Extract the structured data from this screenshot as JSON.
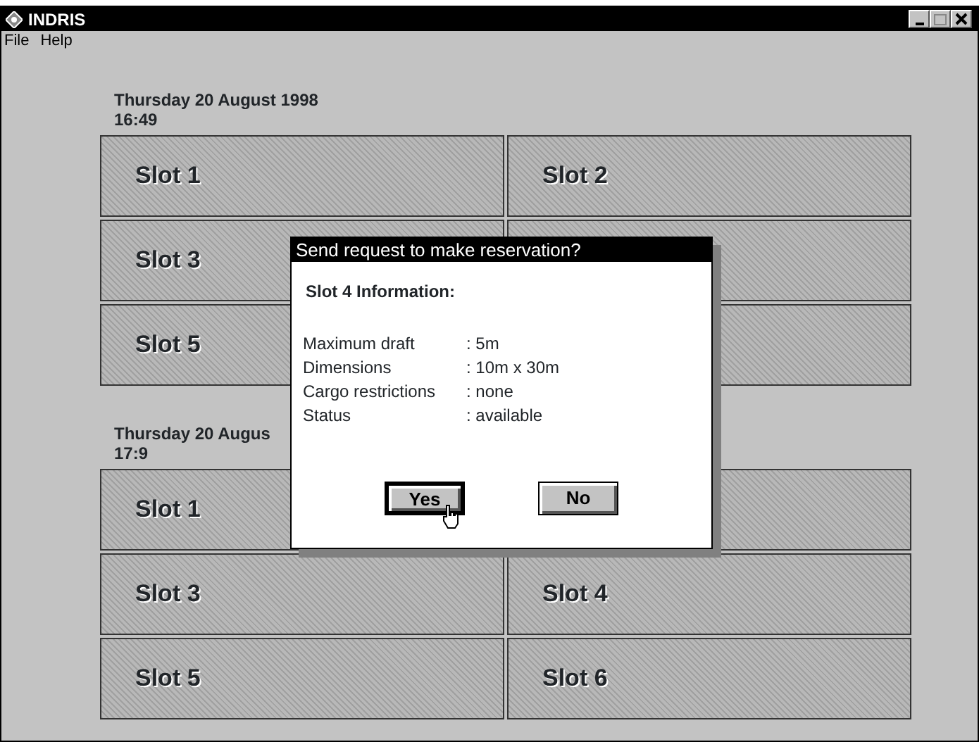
{
  "window": {
    "title": "INDRIS"
  },
  "menu": [
    "File",
    "Help"
  ],
  "groups": [
    {
      "date": "Thursday 20 August 1998",
      "time": "16:49",
      "slots": [
        {
          "kind": "slot",
          "label": "Slot 1"
        },
        {
          "kind": "slot",
          "label": "Slot 2"
        },
        {
          "kind": "slot",
          "label": "Slot 3"
        },
        {
          "kind": "covered"
        },
        {
          "kind": "slot",
          "label": "Slot 5"
        },
        {
          "kind": "covered"
        }
      ]
    },
    {
      "date": "Thursday 20 Augus",
      "time": "17:9",
      "slots": [
        {
          "kind": "slot",
          "label": "Slot 1"
        },
        {
          "kind": "covered"
        },
        {
          "kind": "slot",
          "label": "Slot 3"
        },
        {
          "kind": "slot",
          "label": "Slot 4"
        },
        {
          "kind": "slot",
          "label": "Slot 5"
        },
        {
          "kind": "slot",
          "label": "Slot 6"
        }
      ]
    }
  ],
  "dialog": {
    "title": "Send request to make reservation?",
    "heading": "Slot 4 Information:",
    "fields": [
      {
        "label": "Maximum draft",
        "value": ": 5m"
      },
      {
        "label": "Dimensions",
        "value": ": 10m x 30m"
      },
      {
        "label": "Cargo restrictions",
        "value": ": none"
      },
      {
        "label": "Status",
        "value": ": available"
      }
    ],
    "buttons": [
      {
        "label": "Yes",
        "default": true
      },
      {
        "label": "No",
        "default": false
      }
    ]
  }
}
